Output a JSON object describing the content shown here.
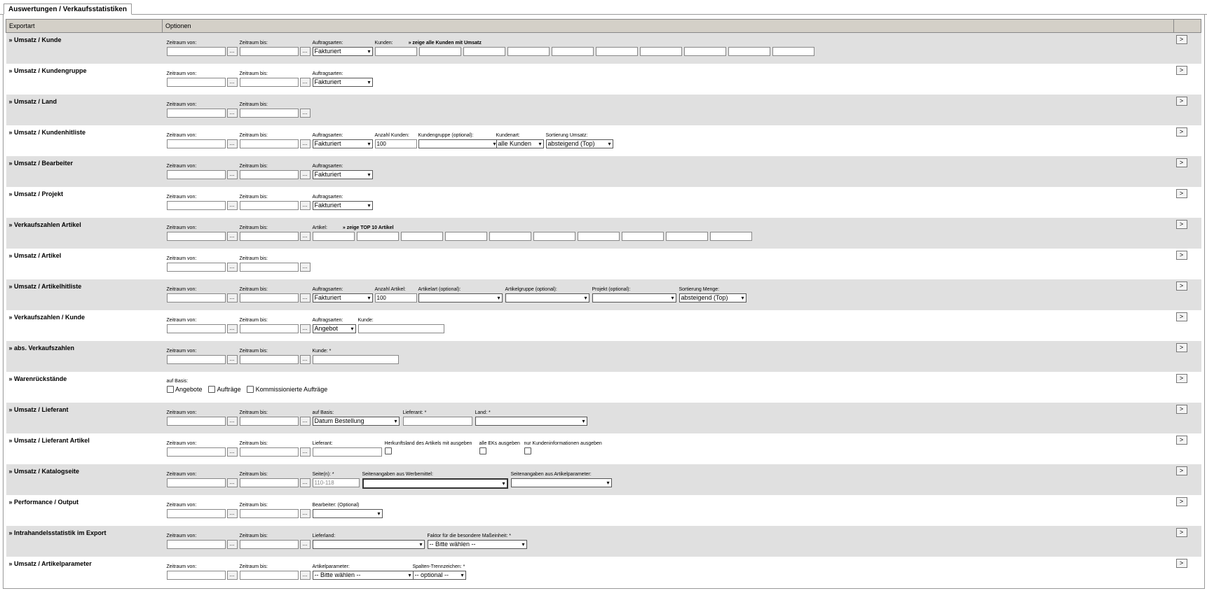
{
  "tab": {
    "label": "Auswertungen / Verkaufsstatistiken"
  },
  "header": {
    "exportart": "Exportart",
    "optionen": "Optionen"
  },
  "common": {
    "von": "Zeitraum von:",
    "bis": "Zeitraum bis:",
    "dots": "...",
    "go": ">",
    "chevron": "▾"
  },
  "rows": {
    "r1": {
      "title": "» Umsatz / Kunde",
      "auftragsarten": "Auftragsarten:",
      "auftragsarten_value": "Fakturiert",
      "kunden": "Kunden:",
      "link": "» zeige alle Kunden mit Umsatz"
    },
    "r2": {
      "title": "» Umsatz / Kundengruppe",
      "auftragsarten": "Auftragsarten:",
      "auftragsarten_value": "Fakturiert"
    },
    "r3": {
      "title": "» Umsatz / Land"
    },
    "r4": {
      "title": "» Umsatz / Kundenhitliste",
      "auftragsarten": "Auftragsarten:",
      "auftragsarten_value": "Fakturiert",
      "anzahl": "Anzahl Kunden:",
      "anzahl_value": "100",
      "gruppe": "Kundengruppe (optional):",
      "kundenart": "Kundenart:",
      "kundenart_value": "alle Kunden",
      "sort": "Sortierung Umsatz:",
      "sort_value": "absteigend (Top)"
    },
    "r5": {
      "title": "» Umsatz / Bearbeiter",
      "auftragsarten": "Auftragsarten:",
      "auftragsarten_value": "Fakturiert"
    },
    "r6": {
      "title": "» Umsatz / Projekt",
      "auftragsarten": "Auftragsarten:",
      "auftragsarten_value": "Fakturiert"
    },
    "r7": {
      "title": "» Verkaufszahlen Artikel",
      "artikel": "Artikel:",
      "link": "» zeige TOP 10 Artikel"
    },
    "r8": {
      "title": "» Umsatz / Artikel"
    },
    "r9": {
      "title": "» Umsatz / Artikelhitliste",
      "auftragsarten": "Auftragsarten:",
      "auftragsarten_value": "Fakturiert",
      "anzahl": "Anzahl Artikel:",
      "anzahl_value": "100",
      "artikelart": "Artikelart (optional):",
      "artikelgruppe": "Artikelgruppe (optional):",
      "projekt": "Projekt (optional):",
      "sort": "Sortierung Menge:",
      "sort_value": "absteigend (Top)"
    },
    "r10": {
      "title": "» Verkaufszahlen / Kunde",
      "auftragsarten": "Auftragsarten:",
      "auftragsarten_value": "Angebot",
      "kunde": "Kunde:"
    },
    "r11": {
      "title": "» abs. Verkaufszahlen",
      "kunde": "Kunde: *"
    },
    "r12": {
      "title": "» Warenrückstände",
      "basis": "auf Basis:",
      "cb1": "Angebote",
      "cb2": "Aufträge",
      "cb3": "Kommissionierte Aufträge"
    },
    "r13": {
      "title": "» Umsatz / Lieferant",
      "basis": "auf Basis:",
      "basis_value": "Datum Bestellung",
      "lieferant": "Lieferant: *",
      "land": "Land: *"
    },
    "r14": {
      "title": "» Umsatz / Lieferant Artikel",
      "lieferant": "Lieferant:",
      "herkunft": "Herkunftsland des Artikels mit ausgeben",
      "eks": "alle EKs ausgeben",
      "kundeninfo": "nur Kundeninformationen ausgeben"
    },
    "r15": {
      "title": "» Umsatz / Katalogseite",
      "seiten": "Seite(n): *",
      "seiten_ph": "110-118",
      "werbemittel": "Seitenangaben aus Werbemittel:",
      "artikelparameter": "Seitenangaben aus Artikelparameter:"
    },
    "r16": {
      "title": "» Performance / Output",
      "bearbeiter": "Bearbeiter: (Optional)"
    },
    "r17": {
      "title": "» Intrahandelsstatistik im Export",
      "lieferland": "Lieferland:",
      "faktor": "Faktor für die besondere Maßeinheit: *",
      "faktor_value": "-- Bitte wählen --"
    },
    "r18": {
      "title": "» Umsatz / Artikelparameter",
      "parameter": "Artikelparameter:",
      "parameter_value": "-- Bitte wählen --",
      "trenn": "Spalten-Trennzeichen: *",
      "trenn_value": "-- optional --"
    }
  }
}
